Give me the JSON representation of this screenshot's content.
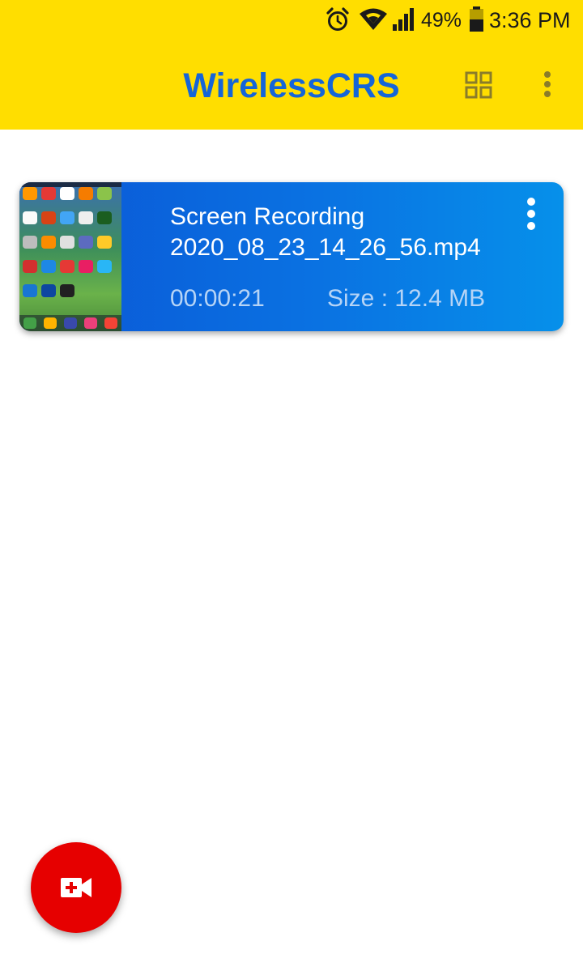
{
  "status_bar": {
    "battery_percent": "49%",
    "time": "3:36 PM",
    "icons": [
      "alarm-icon",
      "wifi-icon",
      "cellular-signal-icon",
      "battery-icon"
    ],
    "background": "#ffde00"
  },
  "app_bar": {
    "title": "WirelessCRS",
    "title_color": "#1565d8",
    "background": "#ffde00",
    "actions": [
      "grid-view-icon",
      "overflow-menu-icon"
    ]
  },
  "recordings": [
    {
      "name": "Screen Recording\n2020_08_23_14_26_56.mp4",
      "duration": "00:00:21",
      "size": "Size : 12.4 MB",
      "thumbnail": "home-screen-thumbnail",
      "menu_icon": "overflow-menu-icon"
    }
  ],
  "fab": {
    "icon": "add-video-icon",
    "color": "#e60000"
  }
}
